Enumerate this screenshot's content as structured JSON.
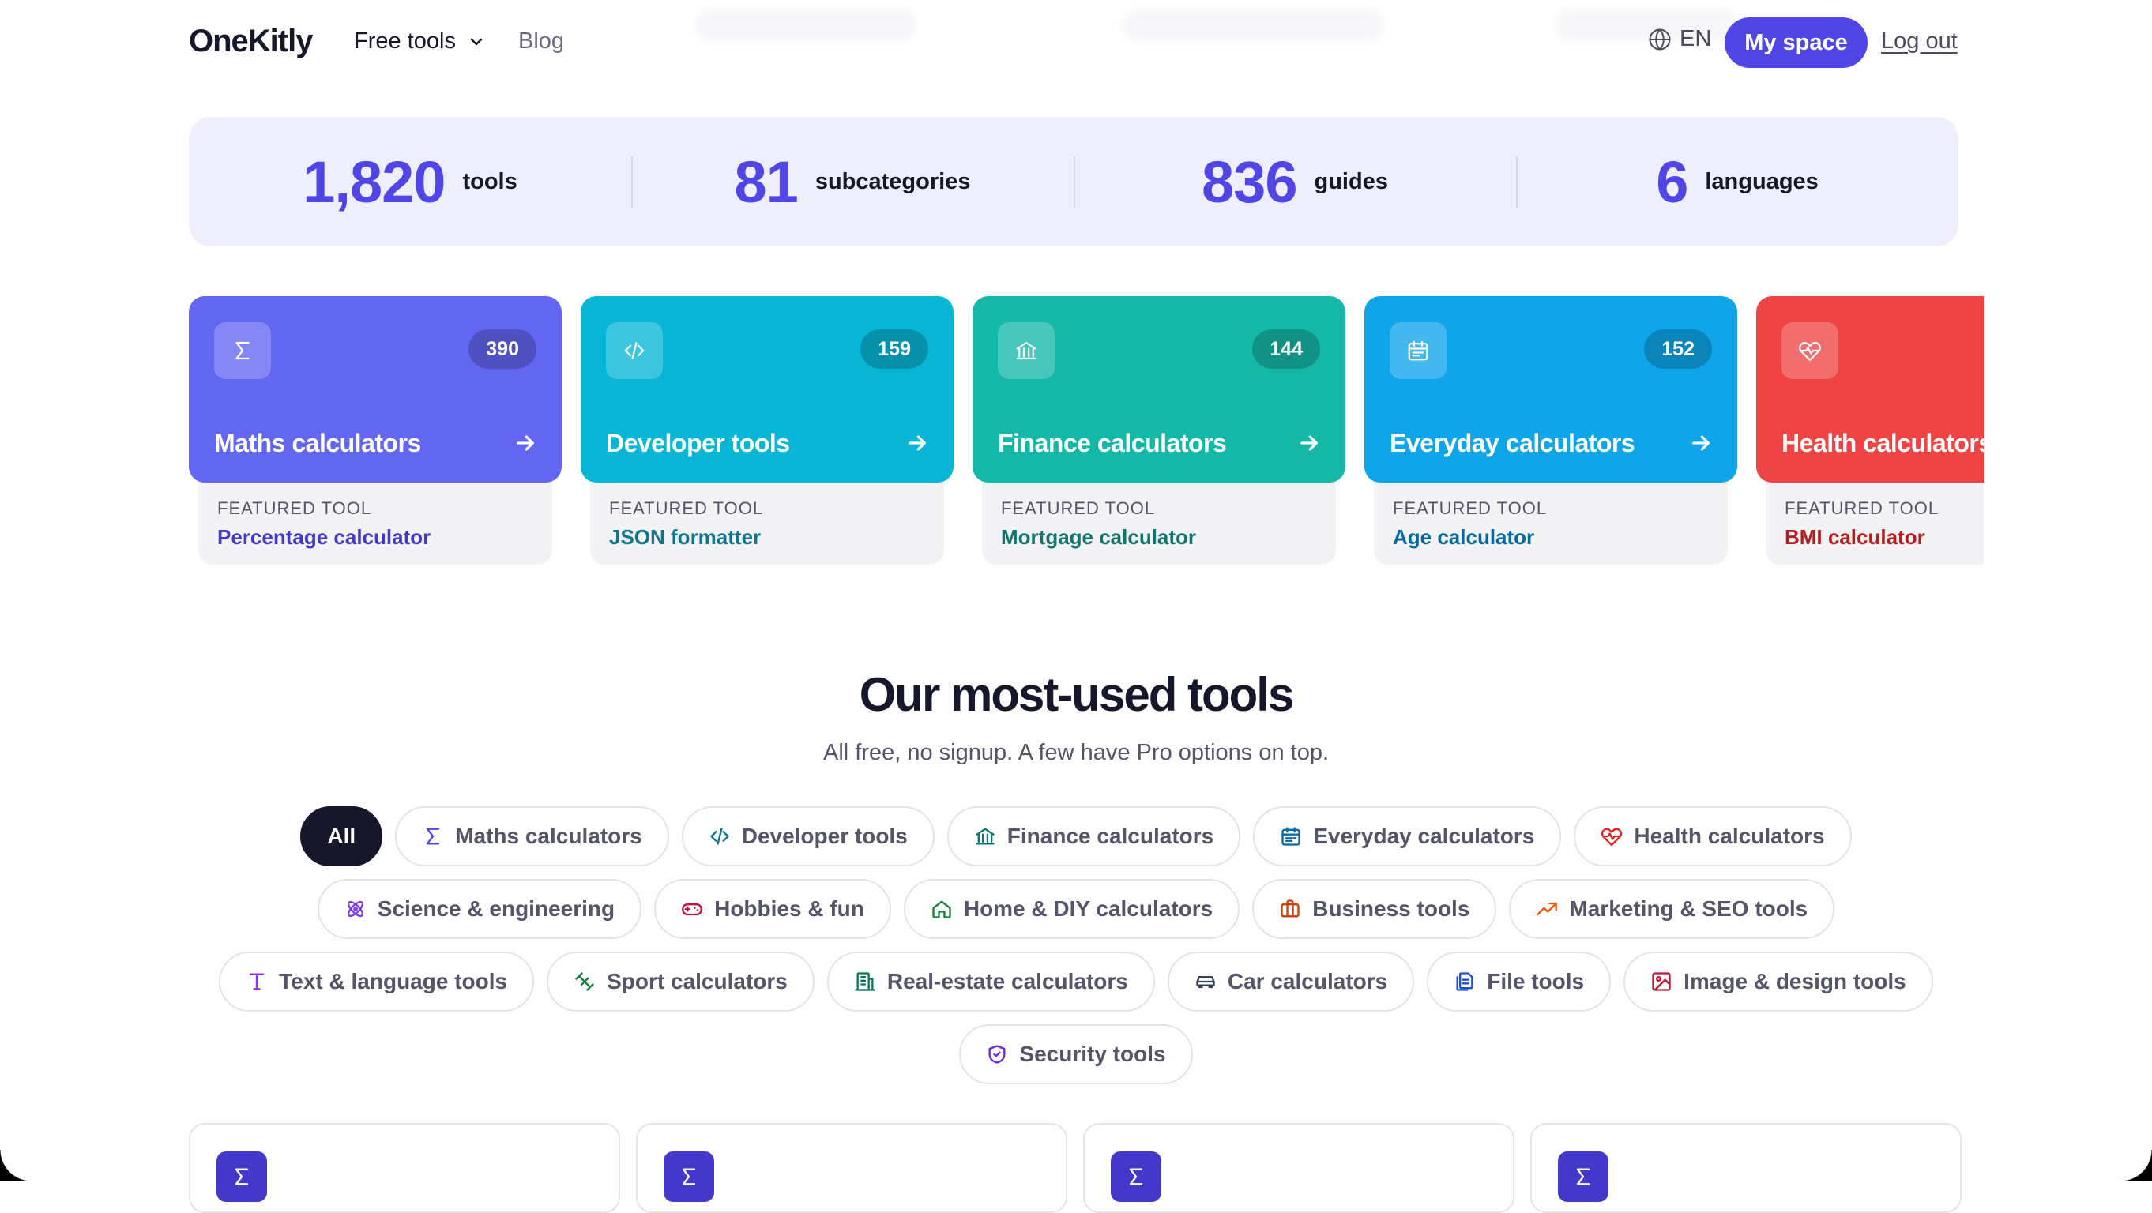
{
  "header": {
    "logo": "OneKitly",
    "nav": {
      "free_tools": "Free tools",
      "blog": "Blog"
    },
    "language": "EN",
    "my_space": "My space",
    "log_out": "Log out"
  },
  "stats": [
    {
      "value": "1,820",
      "label": "tools"
    },
    {
      "value": "81",
      "label": "subcategories"
    },
    {
      "value": "836",
      "label": "guides"
    },
    {
      "value": "6",
      "label": "languages"
    }
  ],
  "categories": [
    {
      "title": "Maths calculators",
      "count": "390",
      "icon": "sigma-icon",
      "color": "#6366f1",
      "featured_label": "FEATURED TOOL",
      "featured": "Percentage calculator",
      "featured_color": "#4338ca"
    },
    {
      "title": "Developer tools",
      "count": "159",
      "icon": "code-icon",
      "color": "#06b6d4",
      "featured_label": "FEATURED TOOL",
      "featured": "JSON formatter",
      "featured_color": "#0e7490"
    },
    {
      "title": "Finance calculators",
      "count": "144",
      "icon": "bank-icon",
      "color": "#14b8a6",
      "featured_label": "FEATURED TOOL",
      "featured": "Mortgage calculator",
      "featured_color": "#0f766e"
    },
    {
      "title": "Everyday calculators",
      "count": "152",
      "icon": "calendar-icon",
      "color": "#0ea5e9",
      "featured_label": "FEATURED TOOL",
      "featured": "Age calculator",
      "featured_color": "#0369a1"
    },
    {
      "title": "Health calculators",
      "count": "",
      "icon": "heart-pulse-icon",
      "color": "#ef4444",
      "featured_label": "FEATURED TOOL",
      "featured": "BMI calculator",
      "featured_color": "#b91c1c"
    }
  ],
  "most_used": {
    "title": "Our most-used tools",
    "subtitle": "All free, no signup. A few have Pro options on top."
  },
  "filters": [
    {
      "label": "All",
      "active": true
    },
    {
      "label": "Maths calculators",
      "icon": "sigma-icon",
      "color": "#4f46e5"
    },
    {
      "label": "Developer tools",
      "icon": "code-icon",
      "color": "#0e7490"
    },
    {
      "label": "Finance calculators",
      "icon": "bank-icon",
      "color": "#0f766e"
    },
    {
      "label": "Everyday calculators",
      "icon": "calendar-icon",
      "color": "#0369a1"
    },
    {
      "label": "Health calculators",
      "icon": "heart-pulse-icon",
      "color": "#dc2626"
    },
    {
      "label": "Science & engineering",
      "icon": "atom-icon",
      "color": "#7c3aed"
    },
    {
      "label": "Hobbies & fun",
      "icon": "gamepad-icon",
      "color": "#be123c"
    },
    {
      "label": "Home & DIY calculators",
      "icon": "home-icon",
      "color": "#15803d"
    },
    {
      "label": "Business tools",
      "icon": "briefcase-icon",
      "color": "#c2410c"
    },
    {
      "label": "Marketing & SEO tools",
      "icon": "trending-up-icon",
      "color": "#ea580c"
    },
    {
      "label": "Text & language tools",
      "icon": "type-icon",
      "color": "#9333ea"
    },
    {
      "label": "Sport calculators",
      "icon": "dumbbell-icon",
      "color": "#15803d"
    },
    {
      "label": "Real-estate calculators",
      "icon": "building-icon",
      "color": "#047857"
    },
    {
      "label": "Car calculators",
      "icon": "car-icon",
      "color": "#334155"
    },
    {
      "label": "File tools",
      "icon": "files-icon",
      "color": "#1d4ed8"
    },
    {
      "label": "Image & design tools",
      "icon": "image-icon",
      "color": "#be123c"
    },
    {
      "label": "Security tools",
      "icon": "shield-icon",
      "color": "#6d28d9"
    }
  ],
  "tool_cards": [
    {
      "icon": "sigma-icon"
    },
    {
      "icon": "sigma-icon"
    },
    {
      "icon": "sigma-icon"
    },
    {
      "icon": "sigma-icon"
    }
  ]
}
